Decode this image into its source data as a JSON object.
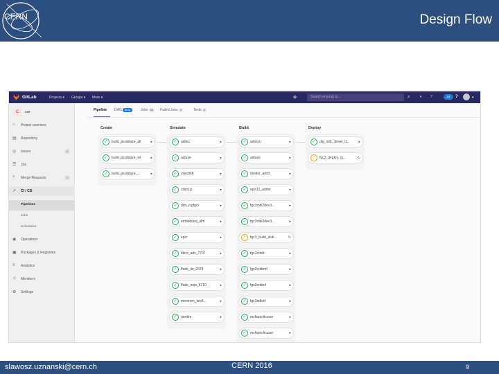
{
  "slide": {
    "title": "Design Flow",
    "logo_text": "CERN",
    "footer_email": "slawosz.uznanski@cern.ch",
    "footer_center": "CERN 2016",
    "page_number": "9",
    "header_color": "#2c4f7f"
  },
  "gitlab": {
    "brand": "GitLab",
    "nav": [
      "Projects ▾",
      "Groups ▾",
      "More ▾"
    ],
    "search_placeholder": "Search or jump to...",
    "todo_count": "24",
    "project_letter": "C",
    "project_name": "cse",
    "sidebar": [
      {
        "icon": "home-icon",
        "glyph": "⌂",
        "label": "Project overview"
      },
      {
        "icon": "book-icon",
        "glyph": "▤",
        "label": "Repository"
      },
      {
        "icon": "issues-icon",
        "glyph": "◎",
        "label": "Issues",
        "count": "2"
      },
      {
        "icon": "board-icon",
        "glyph": "☰",
        "label": "Jira"
      },
      {
        "icon": "merge-request-icon",
        "glyph": "⑂",
        "label": "Merge Requests",
        "count": "1"
      },
      {
        "icon": "rocket-icon",
        "glyph": "➚",
        "label": "CI / CD",
        "active": true
      },
      {
        "icon": "operations-icon",
        "glyph": "◉",
        "label": "Operations"
      },
      {
        "icon": "package-icon",
        "glyph": "▣",
        "label": "Packages & Registries"
      },
      {
        "icon": "chart-icon",
        "glyph": "≡",
        "label": "Analytics"
      },
      {
        "icon": "users-icon",
        "glyph": "☺",
        "label": "Members"
      },
      {
        "icon": "gear-icon",
        "glyph": "⚙",
        "label": "Settings"
      }
    ],
    "cicd_sub": [
      "Pipelines",
      "Jobs",
      "Schedules"
    ],
    "tabs": [
      {
        "label": "Pipeline",
        "active": true
      },
      {
        "label": "DAG",
        "pill": "Beta"
      },
      {
        "label": "Jobs",
        "count": "59"
      },
      {
        "label": "Failed Jobs",
        "count": "2"
      },
      {
        "label": "Tests",
        "count": "2"
      }
    ]
  },
  "pipeline": {
    "stages": [
      {
        "name": "Create",
        "jobs": [
          {
            "name": "build_picoblaze_all",
            "status": "success",
            "action": "▸"
          },
          {
            "name": "build_picoblaze_wl",
            "status": "success",
            "action": "▸"
          },
          {
            "name": "build_picoblaze_...",
            "status": "success",
            "action": "▸"
          }
        ]
      },
      {
        "name": "Simulate",
        "jobs": [
          {
            "name": "adiinc",
            "status": "success",
            "action": "▸"
          },
          {
            "name": "adiuse",
            "status": "success",
            "action": "▸"
          },
          {
            "name": "clkrx96h",
            "status": "success",
            "action": "▸"
          },
          {
            "name": "clkrx1g",
            "status": "success",
            "action": "▸"
          },
          {
            "name": "dim_rcgfgrs",
            "status": "success",
            "action": "▸"
          },
          {
            "name": "embedded_alm",
            "status": "success",
            "action": "▸"
          },
          {
            "name": "epic",
            "status": "success",
            "action": "▸"
          },
          {
            "name": "fdsrc_ads_7707",
            "status": "success",
            "action": "▸"
          },
          {
            "name": "ffadc_ltc_2378",
            "status": "success",
            "action": "▸"
          },
          {
            "name": "ffadc_max_5710",
            "status": "success",
            "action": "▸"
          },
          {
            "name": "memrom_tsicfl...",
            "status": "success",
            "action": "▸"
          },
          {
            "name": "randim",
            "status": "success",
            "action": "▸"
          }
        ]
      },
      {
        "name": "Build",
        "jobs": [
          {
            "name": "adiincn",
            "status": "success",
            "action": "▸"
          },
          {
            "name": "adiuse",
            "status": "success",
            "action": "▸"
          },
          {
            "name": "divider_artr8",
            "status": "success",
            "action": "▸"
          },
          {
            "name": "epic11_adder",
            "status": "success",
            "action": "▸"
          },
          {
            "name": "fgc3mbl2dev3...",
            "status": "success",
            "action": "▸"
          },
          {
            "name": "fgc3mbl2dev3...",
            "status": "success",
            "action": "▸"
          },
          {
            "name": "fgc3_build_skib...",
            "status": "warning",
            "action": "↻"
          },
          {
            "name": "fgc3crdet",
            "status": "success",
            "action": "▸"
          },
          {
            "name": "fgc3crdbmf",
            "status": "success",
            "action": "▸"
          },
          {
            "name": "fgc3crdbcf",
            "status": "success",
            "action": "▸"
          },
          {
            "name": "fgc3adbdf",
            "status": "success",
            "action": "▸"
          },
          {
            "name": "mcfspecficuser",
            "status": "success",
            "action": "▸"
          },
          {
            "name": "mcfspecficuser",
            "status": "success",
            "action": "▸"
          }
        ]
      },
      {
        "name": "Deploy",
        "jobs": [
          {
            "name": "dig_intfc_devel_d...",
            "status": "success",
            "action": "▸"
          },
          {
            "name": "fgc3_deploy_m...",
            "status": "warning",
            "action": "↻"
          }
        ]
      }
    ]
  }
}
